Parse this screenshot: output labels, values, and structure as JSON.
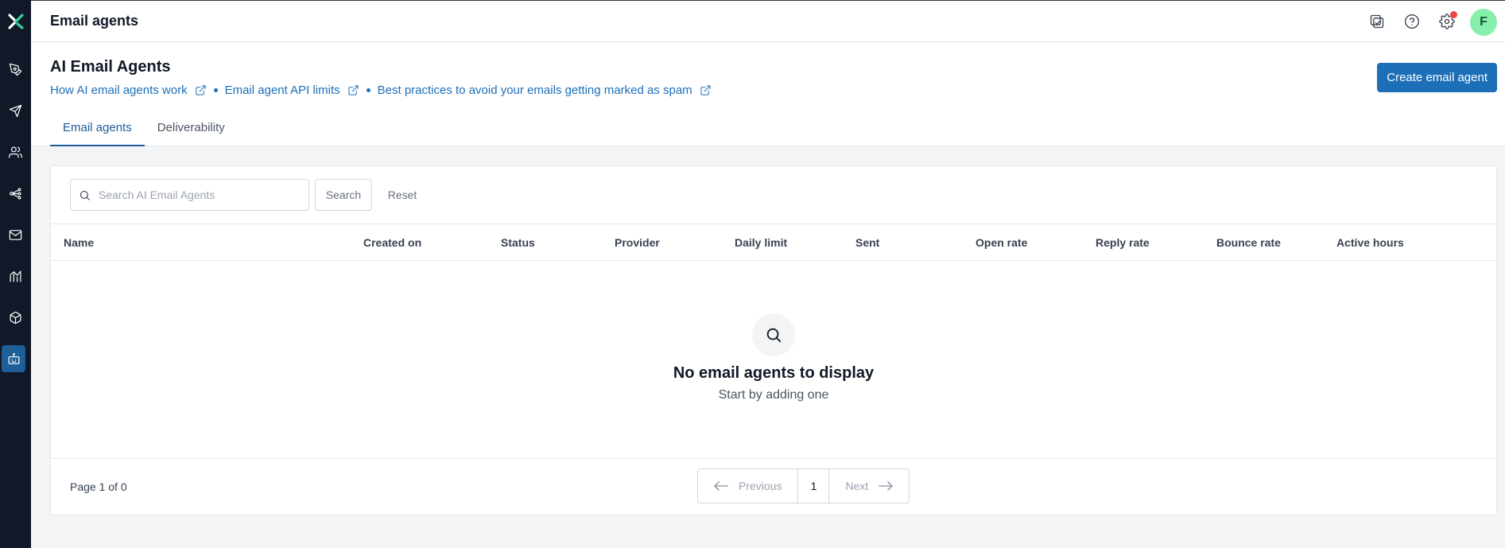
{
  "header": {
    "title": "Email agents",
    "avatar_initial": "F"
  },
  "page": {
    "title": "AI Email Agents",
    "links": [
      {
        "label": "How AI email agents work"
      },
      {
        "label": "Email agent API limits"
      },
      {
        "label": "Best practices to avoid your emails getting marked as spam"
      }
    ],
    "create_button": "Create email agent"
  },
  "tabs": [
    {
      "label": "Email agents",
      "active": true
    },
    {
      "label": "Deliverability",
      "active": false
    }
  ],
  "search": {
    "placeholder": "Search AI Email Agents",
    "value": "",
    "search_label": "Search",
    "reset_label": "Reset"
  },
  "table": {
    "columns": [
      "Name",
      "Created on",
      "Status",
      "Provider",
      "Daily limit",
      "Sent",
      "Open rate",
      "Reply rate",
      "Bounce rate",
      "Active hours"
    ],
    "rows": []
  },
  "empty_state": {
    "title": "No email agents to display",
    "subtitle": "Start by adding one"
  },
  "pagination": {
    "info": "Page 1 of 0",
    "previous": "Previous",
    "next": "Next",
    "current_page": "1"
  },
  "colors": {
    "sidebar_bg": "#111827",
    "accent": "#1d6fb8",
    "avatar_bg": "#86efac",
    "notification": "#ef4444"
  },
  "icons": {
    "sidebar": [
      "logo",
      "pen-nib-icon",
      "send-icon",
      "users-icon",
      "workflow-icon",
      "mail-icon",
      "analytics-icon",
      "package-icon",
      "bot-icon"
    ],
    "topbar": [
      "task-check-icon",
      "help-icon",
      "settings-icon"
    ]
  }
}
